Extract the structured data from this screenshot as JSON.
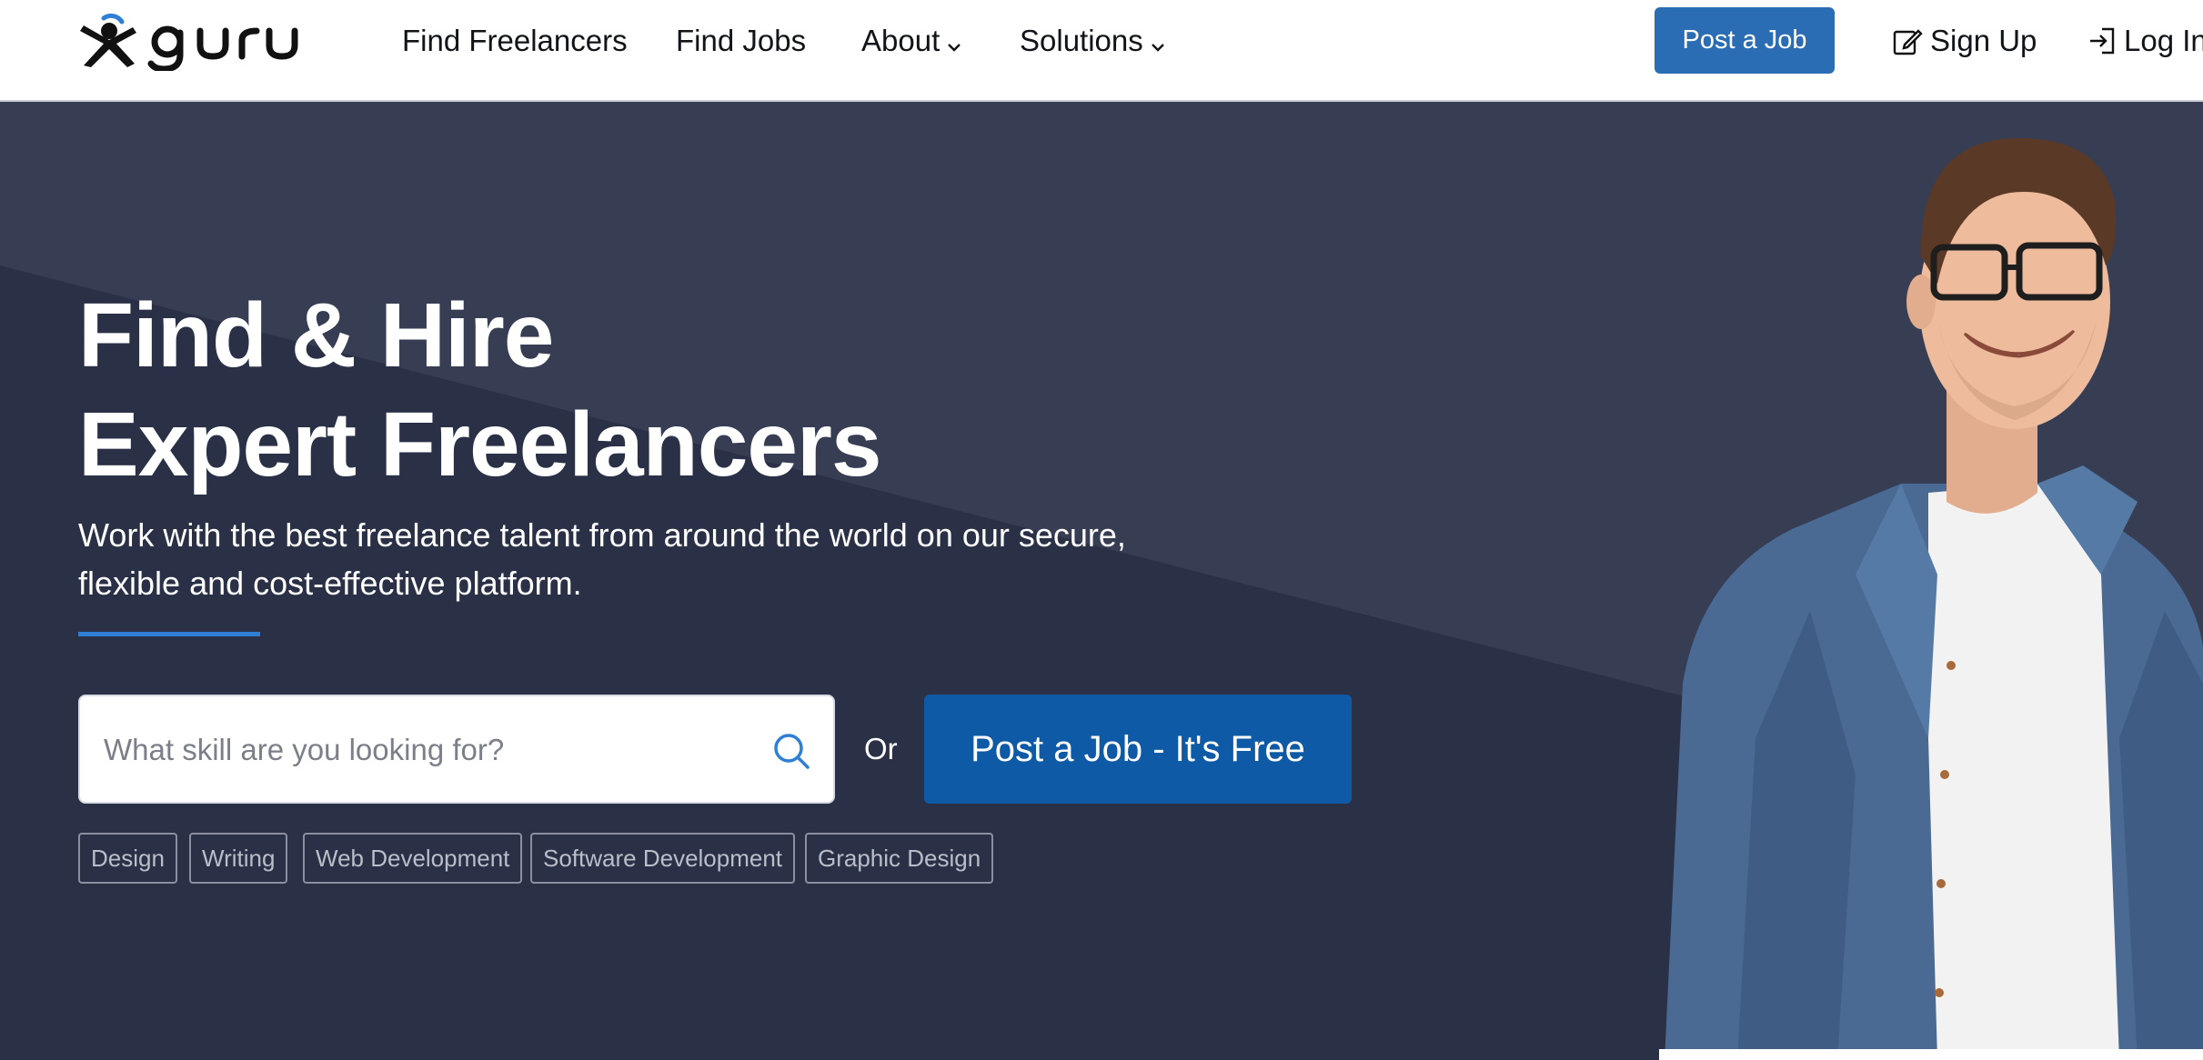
{
  "header": {
    "logo_text": "guru",
    "nav": [
      {
        "label": "Find Freelancers"
      },
      {
        "label": "Find Jobs"
      },
      {
        "label": "About",
        "dropdown": true
      },
      {
        "label": "Solutions",
        "dropdown": true
      }
    ],
    "post_job_label": "Post a Job",
    "sign_up_label": "Sign Up",
    "log_in_label": "Log In"
  },
  "hero": {
    "title_line1": "Find & Hire",
    "title_line2": "Expert Freelancers",
    "subtitle": "Work with the best freelance talent from around the world on our secure, flexible and cost-effective platform.",
    "search_placeholder": "What skill are you looking for?",
    "or_text": "Or",
    "post_job_cta": "Post a Job - It's Free",
    "tags": [
      "Design",
      "Writing",
      "Web Development",
      "Software Development",
      "Graphic Design"
    ]
  },
  "colors": {
    "brand_blue": "#2a6db4",
    "cta_blue": "#0f5aa6",
    "hero_bg": "#2a3146",
    "accent_rule": "#2f7fd6"
  },
  "icons": {
    "logo": "guru-logo-icon",
    "search": "search-icon",
    "sign_up": "edit-icon",
    "log_in": "login-icon",
    "dropdown": "chevron-down-icon"
  }
}
